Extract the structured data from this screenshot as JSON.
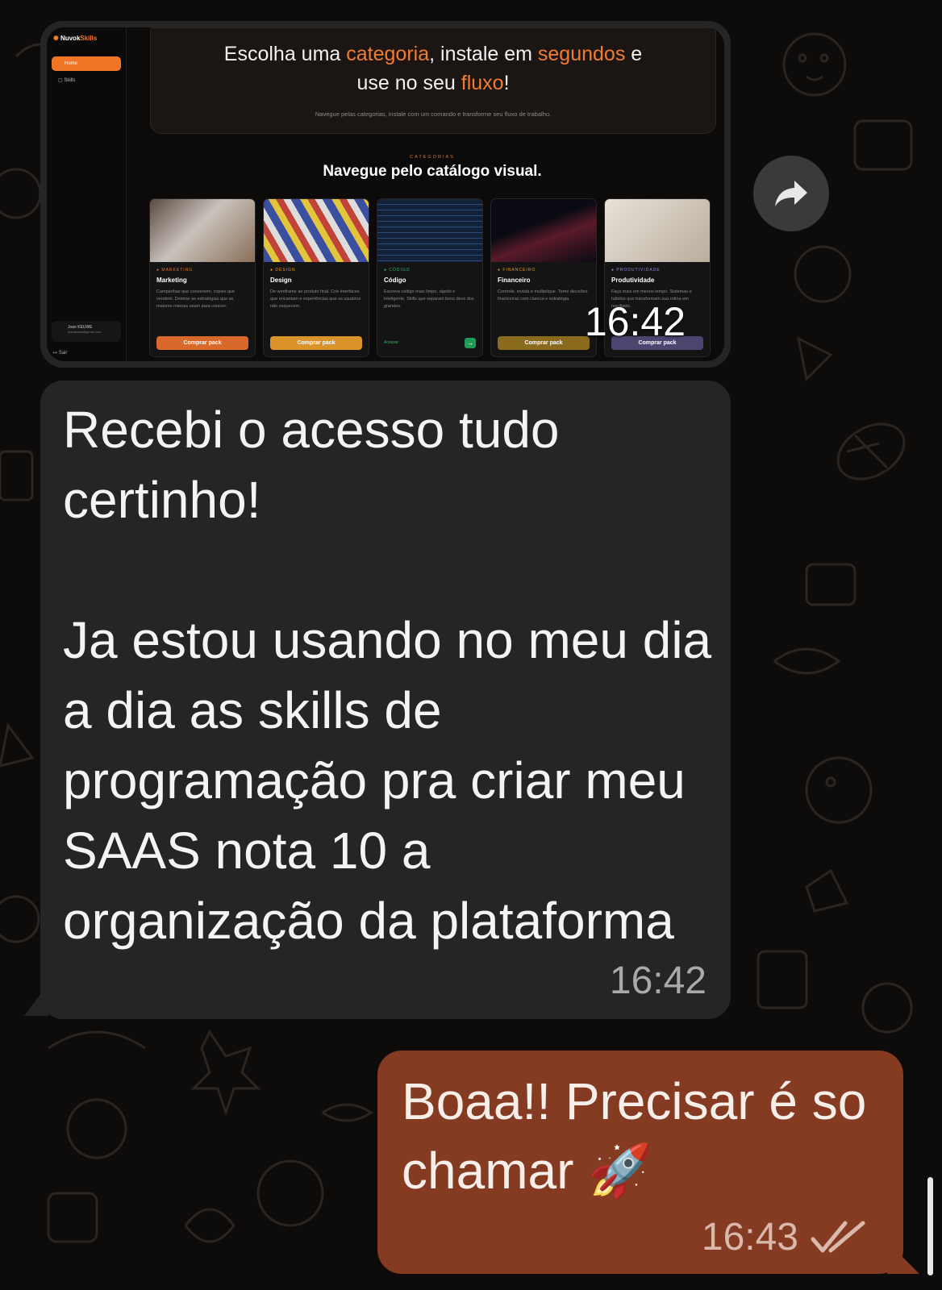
{
  "colors": {
    "chat_background": "#0d0c0b",
    "incoming_bubble": "#252525",
    "outgoing_bubble": "#853a22",
    "accent_orange": "#f27c30"
  },
  "forward_button": {
    "icon": "forward-icon"
  },
  "image_message": {
    "time": "16:42",
    "screenshot": {
      "brand_prefix": "Nuvok",
      "brand_suffix": "Skills",
      "nav": {
        "home": "Home",
        "skills": "Skills"
      },
      "user": {
        "name": "Joao KEUWE",
        "email": "joaokeuwe@gmail.com"
      },
      "logout": "Sair",
      "hero": {
        "t1": "Escolha uma ",
        "t2": "categoria",
        "t3": ", instale em ",
        "t4": "segundos",
        "t5": " e",
        "t6": "use no seu ",
        "t7": "fluxo",
        "t8": "!",
        "subtitle": "Navegue pelas categorias, instale com um comando e transforme seu fluxo de trabalho."
      },
      "catalog": {
        "eyebrow": "CATEGORIAS",
        "heading": "Navegue pelo catálogo visual."
      },
      "cards": [
        {
          "tag": "● MARKETING",
          "name": "Marketing",
          "desc": "Campanhas que convertem, copies que vendem. Domine as estratégias que as maiores marcas usam para crescer.",
          "button": "Comprar pack",
          "tag_color": "#e4772e",
          "btn_color": "#d9692a"
        },
        {
          "tag": "● DESIGN",
          "name": "Design",
          "desc": "De wireframe ao produto final. Crie interfaces que encantam e experiências que os usuários não esquecem.",
          "button": "Comprar pack",
          "tag_color": "#e49a2e",
          "btn_color": "#d9932a"
        },
        {
          "tag": "● CÓDIGO",
          "name": "Código",
          "desc": "Escreva código mais limpo, rápido e inteligente. Skills que separam bons devs dos grandes.",
          "action": "Acessar",
          "arrow": "→",
          "tag_color": "#33b56c"
        },
        {
          "tag": "● FINANCEIRO",
          "name": "Financeiro",
          "desc": "Controle, invista e multiplique. Tome decisões financeiras com clareza e estratégia.",
          "button": "Comprar pack",
          "tag_color": "#d9a02a",
          "btn_color": "#8a6a1c"
        },
        {
          "tag": "● PRODUTIVIDADE",
          "name": "Produtividade",
          "desc": "Faça mais em menos tempo. Sistemas e hábitos que transformam sua rotina em resultado.",
          "button": "Comprar pack",
          "tag_color": "#9a8ae0",
          "btn_color": "#4d4570"
        }
      ]
    }
  },
  "incoming_message": {
    "text": "Recebi o acesso tudo certinho!\n\nJa estou usando no meu dia a dia as skills de programação pra criar meu SAAS nota 10 a organização da plataforma",
    "time": "16:42"
  },
  "outgoing_message": {
    "text": "Boaa!! Precisar é so chamar 🚀",
    "time": "16:43",
    "status_icon": "double-check-icon"
  }
}
